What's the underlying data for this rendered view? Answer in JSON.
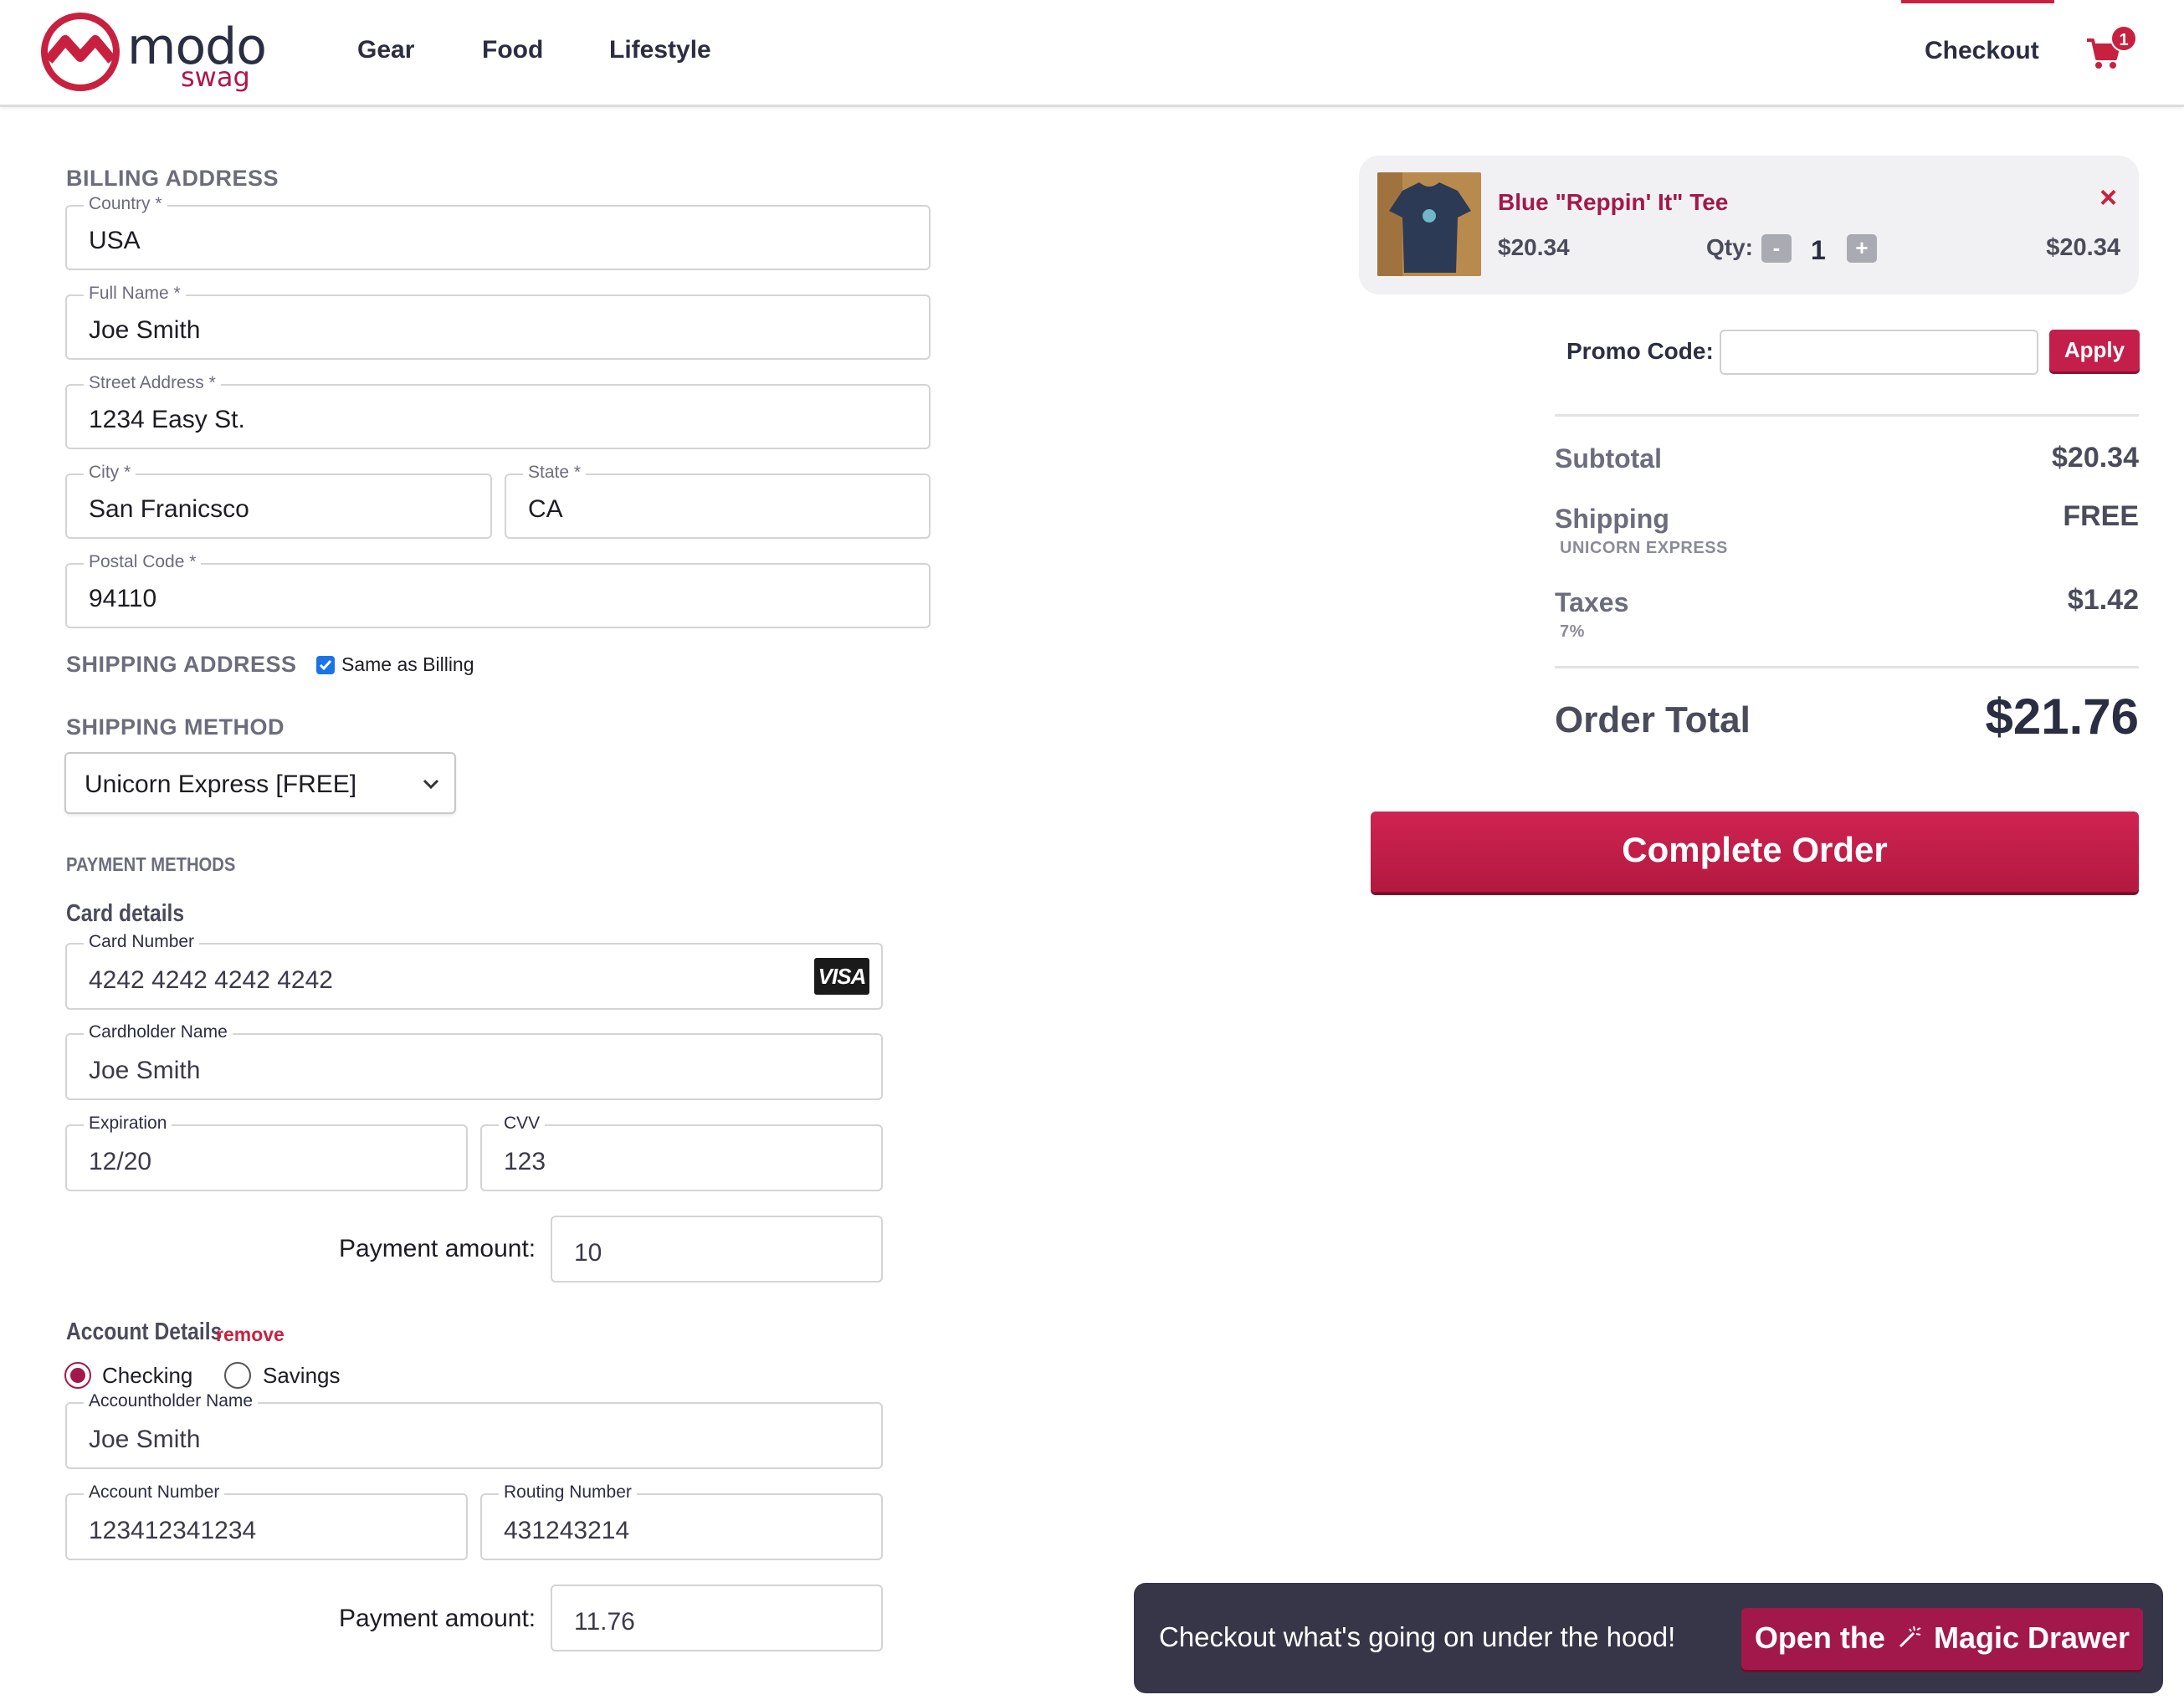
{
  "brand": {
    "name": "modo",
    "sub": "swag",
    "color": "#c8213f",
    "accent": "#a3184a"
  },
  "nav": {
    "links": [
      {
        "label": "Gear"
      },
      {
        "label": "Food"
      },
      {
        "label": "Lifestyle"
      }
    ],
    "checkout": "Checkout",
    "cart_count": "1"
  },
  "billing": {
    "title": "BILLING ADDRESS",
    "country": {
      "label": "Country *",
      "value": "USA"
    },
    "full_name": {
      "label": "Full Name *",
      "value": "Joe Smith"
    },
    "street": {
      "label": "Street Address *",
      "value": "1234 Easy St."
    },
    "city": {
      "label": "City *",
      "value": "San Franicsco"
    },
    "state": {
      "label": "State *",
      "value": "CA"
    },
    "postal": {
      "label": "Postal Code *",
      "value": "94110"
    }
  },
  "shipping_address": {
    "title": "SHIPPING ADDRESS",
    "same_as_billing_label": "Same as Billing",
    "same_as_billing_checked": true
  },
  "shipping_method": {
    "title": "SHIPPING METHOD",
    "selected": "Unicorn Express [FREE]"
  },
  "payment": {
    "title": "PAYMENT METHODS",
    "card": {
      "title": "Card details",
      "number": {
        "label": "Card Number",
        "value": "4242 4242 4242 4242"
      },
      "brand_icon": "VISA",
      "holder": {
        "label": "Cardholder Name",
        "value": "Joe Smith"
      },
      "expiration": {
        "label": "Expiration",
        "value": "12/20"
      },
      "cvv": {
        "label": "CVV",
        "value": "123"
      },
      "amount_label": "Payment amount:",
      "amount": "10"
    },
    "account": {
      "title": "Account Details",
      "remove": "remove",
      "types": [
        {
          "label": "Checking",
          "selected": true
        },
        {
          "label": "Savings",
          "selected": false
        }
      ],
      "holder": {
        "label": "Accountholder Name",
        "value": "Joe Smith"
      },
      "number": {
        "label": "Account Number",
        "value": "123412341234"
      },
      "routing": {
        "label": "Routing Number",
        "value": "431243214"
      },
      "amount_label": "Payment amount:",
      "amount": "11.76"
    }
  },
  "cart": {
    "item": {
      "name": "Blue \"Reppin' It\" Tee",
      "price": "$20.34",
      "qty_label": "Qty:",
      "qty": "1",
      "minus": "-",
      "plus": "+",
      "line_total": "$20.34",
      "remove_icon": "×"
    },
    "promo": {
      "label": "Promo Code:",
      "value": "",
      "apply": "Apply"
    },
    "summary": {
      "subtotal_label": "Subtotal",
      "subtotal": "$20.34",
      "shipping_label": "Shipping",
      "shipping_method": "UNICORN EXPRESS",
      "shipping": "FREE",
      "taxes_label": "Taxes",
      "tax_rate": "7%",
      "taxes": "$1.42",
      "total_label": "Order Total",
      "total": "$21.76"
    },
    "complete_button": "Complete Order"
  },
  "drawer": {
    "text": "Checkout what's going on under the hood!",
    "button_pre": "Open the",
    "button_post": "Magic Drawer"
  }
}
